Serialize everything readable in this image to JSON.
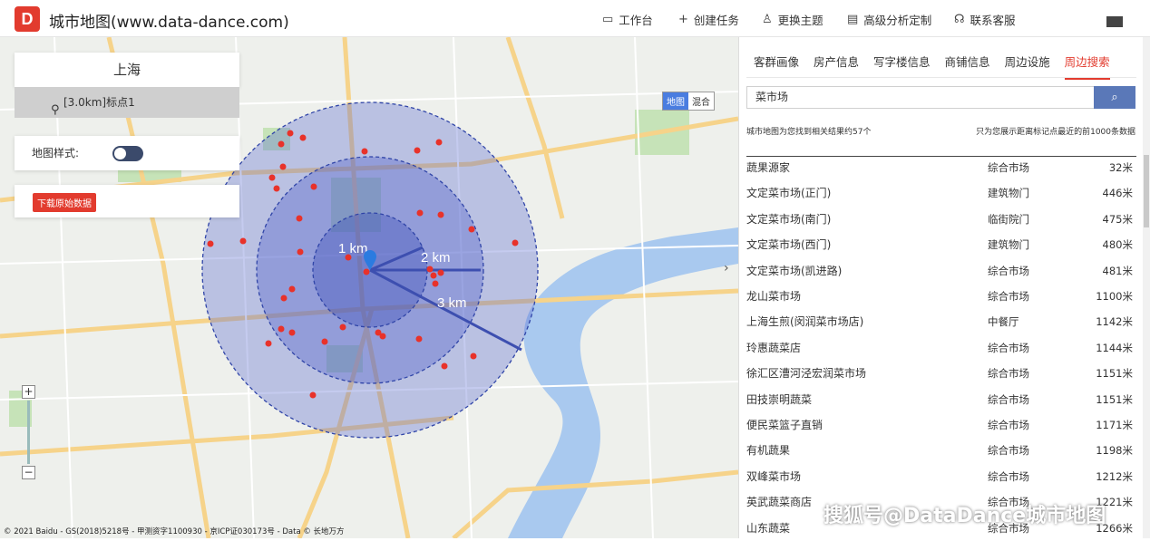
{
  "app": {
    "logo": "D",
    "title": "城市地图(www.data-dance.com)"
  },
  "topnav": [
    {
      "icon": "monitor-icon",
      "glyph": "▭",
      "label": "工作台"
    },
    {
      "icon": "plus-icon",
      "glyph": "+",
      "label": "创建任务"
    },
    {
      "icon": "shirt-icon",
      "glyph": "♙",
      "label": "更换主题"
    },
    {
      "icon": "table-icon",
      "glyph": "▤",
      "label": "高级分析定制"
    },
    {
      "icon": "headset-icon",
      "glyph": "☊",
      "label": "联系客服"
    }
  ],
  "map": {
    "city": "上海",
    "marker_label": "[3.0km]标点1",
    "style_label": "地图样式:",
    "download_label": "下载原始数据",
    "maptype": [
      "地图",
      "混合"
    ],
    "ring_labels": [
      "1 km",
      "2 km",
      "3 km"
    ],
    "copyright": "© 2021 Baidu - GS(2018)5218号 - 甲测资字1100930 - 京ICP证030173号 - Data © 长地万方",
    "zoom_in": "+",
    "zoom_out": "−",
    "collapse_glyph": "›"
  },
  "panel": {
    "tabs": [
      "客群画像",
      "房产信息",
      "写字楼信息",
      "商铺信息",
      "周边设施",
      "周边搜索"
    ],
    "active_tab": "周边搜索",
    "search_value": "菜市场",
    "result_summary": "城市地图为您找到相关结果约57个",
    "result_note": "只为您展示距离标记点最近的前1000条数据",
    "results": [
      {
        "name": "蔬果源家",
        "category": "综合市场",
        "distance": "32米"
      },
      {
        "name": "文定菜市场(正门)",
        "category": "建筑物门",
        "distance": "446米"
      },
      {
        "name": "文定菜市场(南门)",
        "category": "临街院门",
        "distance": "475米"
      },
      {
        "name": "文定菜市场(西门)",
        "category": "建筑物门",
        "distance": "480米"
      },
      {
        "name": "文定菜市场(凯进路)",
        "category": "综合市场",
        "distance": "481米"
      },
      {
        "name": "龙山菜市场",
        "category": "综合市场",
        "distance": "1100米"
      },
      {
        "name": "上海生煎(闵润菜市场店)",
        "category": "中餐厅",
        "distance": "1142米"
      },
      {
        "name": "玲惠蔬菜店",
        "category": "综合市场",
        "distance": "1144米"
      },
      {
        "name": "徐汇区漕河泾宏润菜市场",
        "category": "综合市场",
        "distance": "1151米"
      },
      {
        "name": "田技崇明蔬菜",
        "category": "综合市场",
        "distance": "1151米"
      },
      {
        "name": "便民菜篮子直销",
        "category": "综合市场",
        "distance": "1171米"
      },
      {
        "name": "有机蔬果",
        "category": "综合市场",
        "distance": "1198米"
      },
      {
        "name": "双峰菜市场",
        "category": "综合市场",
        "distance": "1212米"
      },
      {
        "name": "英武蔬菜商店",
        "category": "综合市场",
        "distance": "1221米"
      },
      {
        "name": "山东蔬菜",
        "category": "综合市场",
        "distance": "1266米"
      }
    ]
  },
  "watermark": "搜狐号@DataDance城市地图"
}
